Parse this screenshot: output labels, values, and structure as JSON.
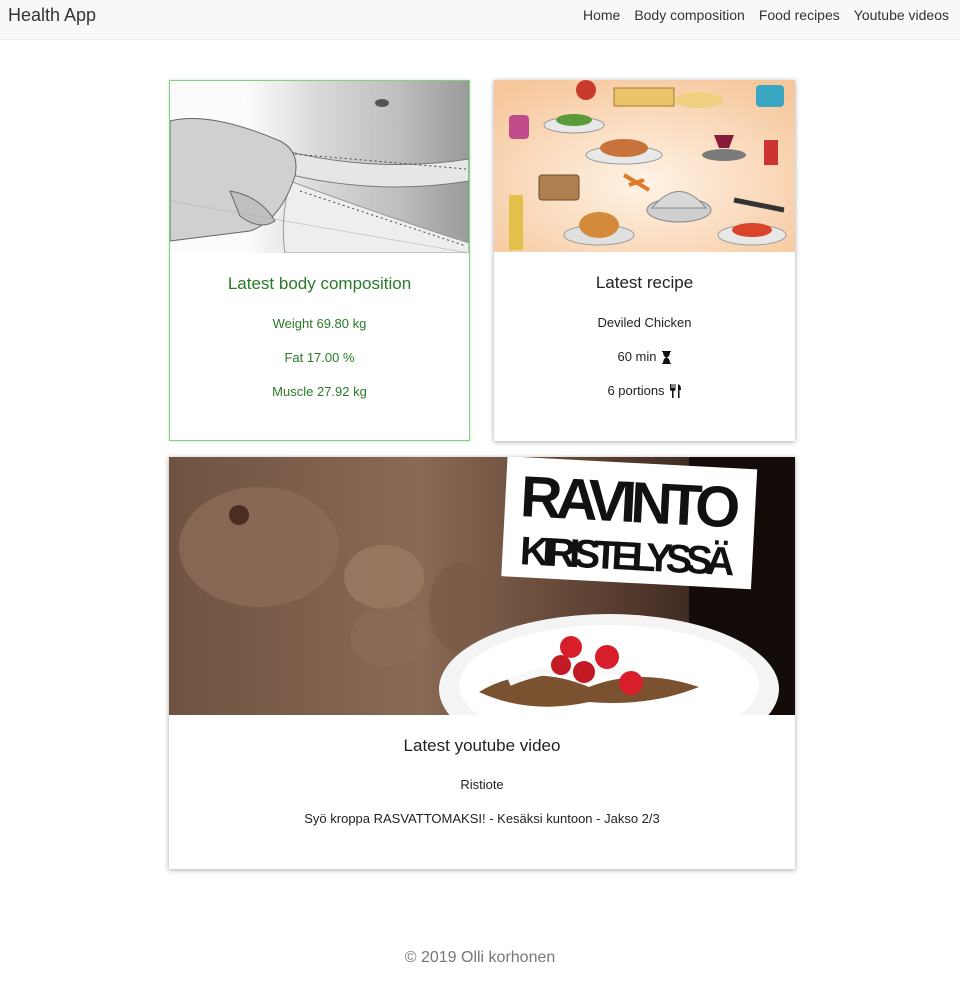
{
  "navbar": {
    "brand": "Health App",
    "links": [
      "Home",
      "Body composition",
      "Food recipes",
      "Youtube videos"
    ]
  },
  "body_card": {
    "title": "Latest body composition",
    "weight": "Weight 69.80 kg",
    "fat": "Fat 17.00 %",
    "muscle": "Muscle 27.92 kg"
  },
  "recipe_card": {
    "title": "Latest recipe",
    "name": "Deviled Chicken",
    "time": "60 min",
    "portions": "6 portions",
    "icons": [
      "hourglass-icon",
      "fork-knife-icon"
    ]
  },
  "video_card": {
    "title": "Latest youtube video",
    "channel": "Ristiote",
    "video_title": "Syö kroppa RASVATTOMAKSI! - Kesäksi kuntoon - Jakso 2/3",
    "thumbnail_text": [
      "RAVINTO",
      "KIRISTELYSSÄ"
    ]
  },
  "footer": {
    "text": "© 2019 Olli korhonen"
  },
  "colors": {
    "accent_green": "#2a7a2a",
    "card_border_green": "#86cf86",
    "navbar_bg": "#f8f8f8"
  }
}
